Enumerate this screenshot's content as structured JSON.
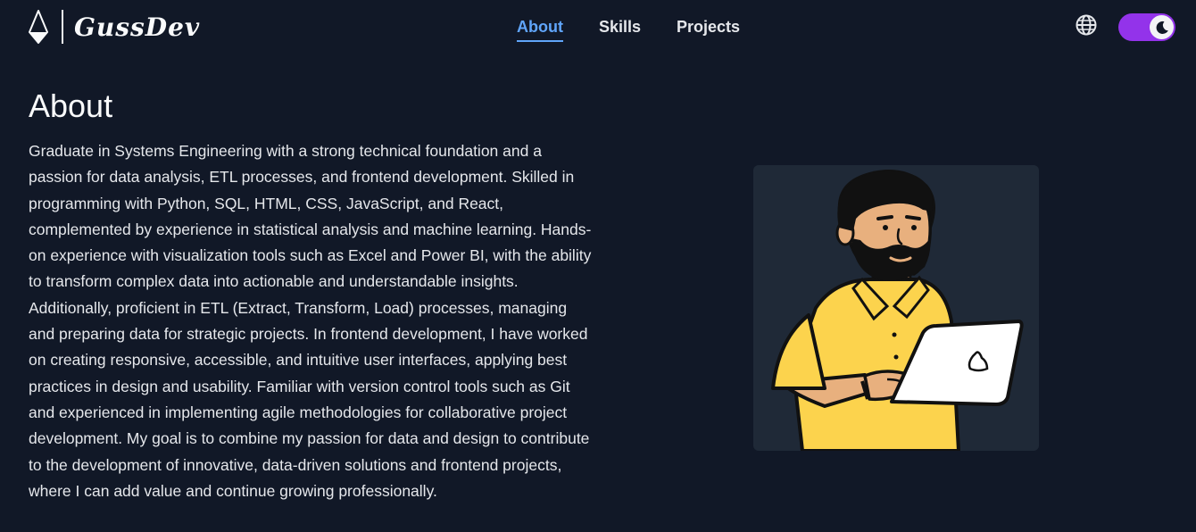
{
  "brand": {
    "name": "GussDev"
  },
  "nav": {
    "links": [
      {
        "label": "About",
        "active": true
      },
      {
        "label": "Skills",
        "active": false
      },
      {
        "label": "Projects",
        "active": false
      }
    ]
  },
  "controls": {
    "language_icon": "globe-icon",
    "theme_toggle_icon": "moon-icon",
    "theme": "dark"
  },
  "about": {
    "title": "About",
    "text": "Graduate in Systems Engineering with a strong technical foundation and a passion for data analysis, ETL processes, and frontend development. Skilled in programming with Python, SQL, HTML, CSS, JavaScript, and React, complemented by experience in statistical analysis and machine learning. Hands-on experience with visualization tools such as Excel and Power BI, with the ability to transform complex data into actionable and understandable insights. Additionally, proficient in ETL (Extract, Transform, Load) processes, managing and preparing data for strategic projects. In frontend development, I have worked on creating responsive, accessible, and intuitive user interfaces, applying best practices in design and usability. Familiar with version control tools such as Git and experienced in implementing agile methodologies for collaborative project development. My goal is to combine my passion for data and design to contribute to the development of innovative, data-driven solutions and frontend projects, where I can add value and continue growing professionally."
  },
  "colors": {
    "background": "#111827",
    "accent": "#60a5fa",
    "toggle": "#9333ea",
    "card": "#1f2937",
    "shirt": "#fcd34d",
    "skin": "#e8b07e"
  }
}
